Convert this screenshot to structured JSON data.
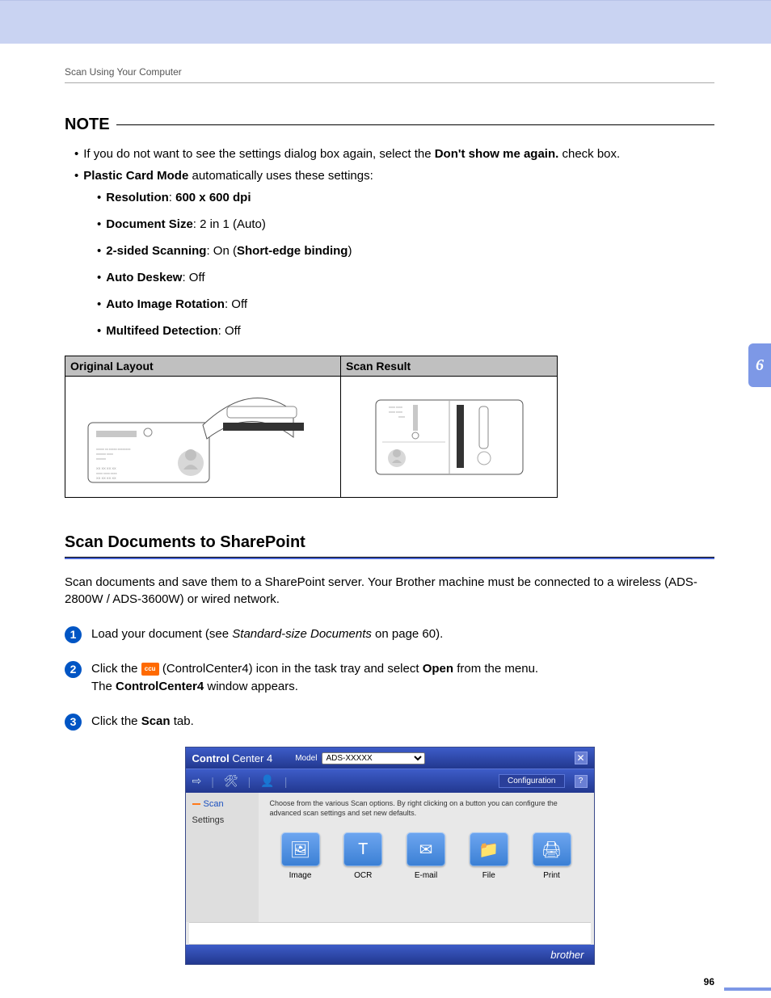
{
  "header": {
    "breadcrumb": "Scan Using Your Computer"
  },
  "note": {
    "title": "NOTE",
    "bullet1_pre": "If you do not want to see the settings dialog box again, select the ",
    "bullet1_bold": "Don't show me again.",
    "bullet1_post": " check box.",
    "bullet2_bold": "Plastic Card Mode",
    "bullet2_post": " automatically uses these settings:",
    "settings": {
      "res_label": "Resolution",
      "res_value": "600 x 600 dpi",
      "size_label": "Document Size",
      "size_value": ": 2 in 1 (Auto)",
      "duplex_label": "2-sided Scanning",
      "duplex_mid": ": On (",
      "duplex_bold2": "Short-edge binding",
      "duplex_post": ")",
      "deskew_label": "Auto Deskew",
      "deskew_value": ": Off",
      "rotate_label": "Auto Image Rotation",
      "rotate_value": ": Off",
      "multi_label": "Multifeed Detection",
      "multi_value": ": Off"
    }
  },
  "table": {
    "h1": "Original Layout",
    "h2": "Scan Result"
  },
  "section": {
    "title": "Scan Documents to SharePoint",
    "intro": "Scan documents and save them to a SharePoint server. Your Brother machine must be connected to a wireless (ADS-2800W / ADS-3600W) or wired network."
  },
  "steps": {
    "s1_pre": "Load your document (see ",
    "s1_italic": "Standard-size Documents",
    "s1_post": " on page 60).",
    "s2_pre": "Click the ",
    "s2_mid": " (ControlCenter4) icon in the task tray and select ",
    "s2_bold": "Open",
    "s2_post": " from the menu.",
    "s2_line2_pre": "The ",
    "s2_line2_bold": "ControlCenter4",
    "s2_line2_post": " window appears.",
    "s3_pre": "Click the ",
    "s3_bold": "Scan",
    "s3_post": " tab."
  },
  "cc": {
    "logo_bold": "Control",
    "logo_light": " Center 4",
    "model_label": "Model",
    "model_value": "ADS-XXXXX",
    "config": "Configuration",
    "tab_scan": "Scan",
    "tab_settings": "Settings",
    "hint": "Choose from the various Scan options. By right clicking on a button you can configure the advanced scan settings and set new defaults.",
    "buttons": {
      "image": "Image",
      "ocr": "OCR",
      "email": "E-mail",
      "file": "File",
      "print": "Print"
    },
    "footer": "brother",
    "icon_text": "ccu"
  },
  "chapter_tab": "6",
  "page_number": "96"
}
